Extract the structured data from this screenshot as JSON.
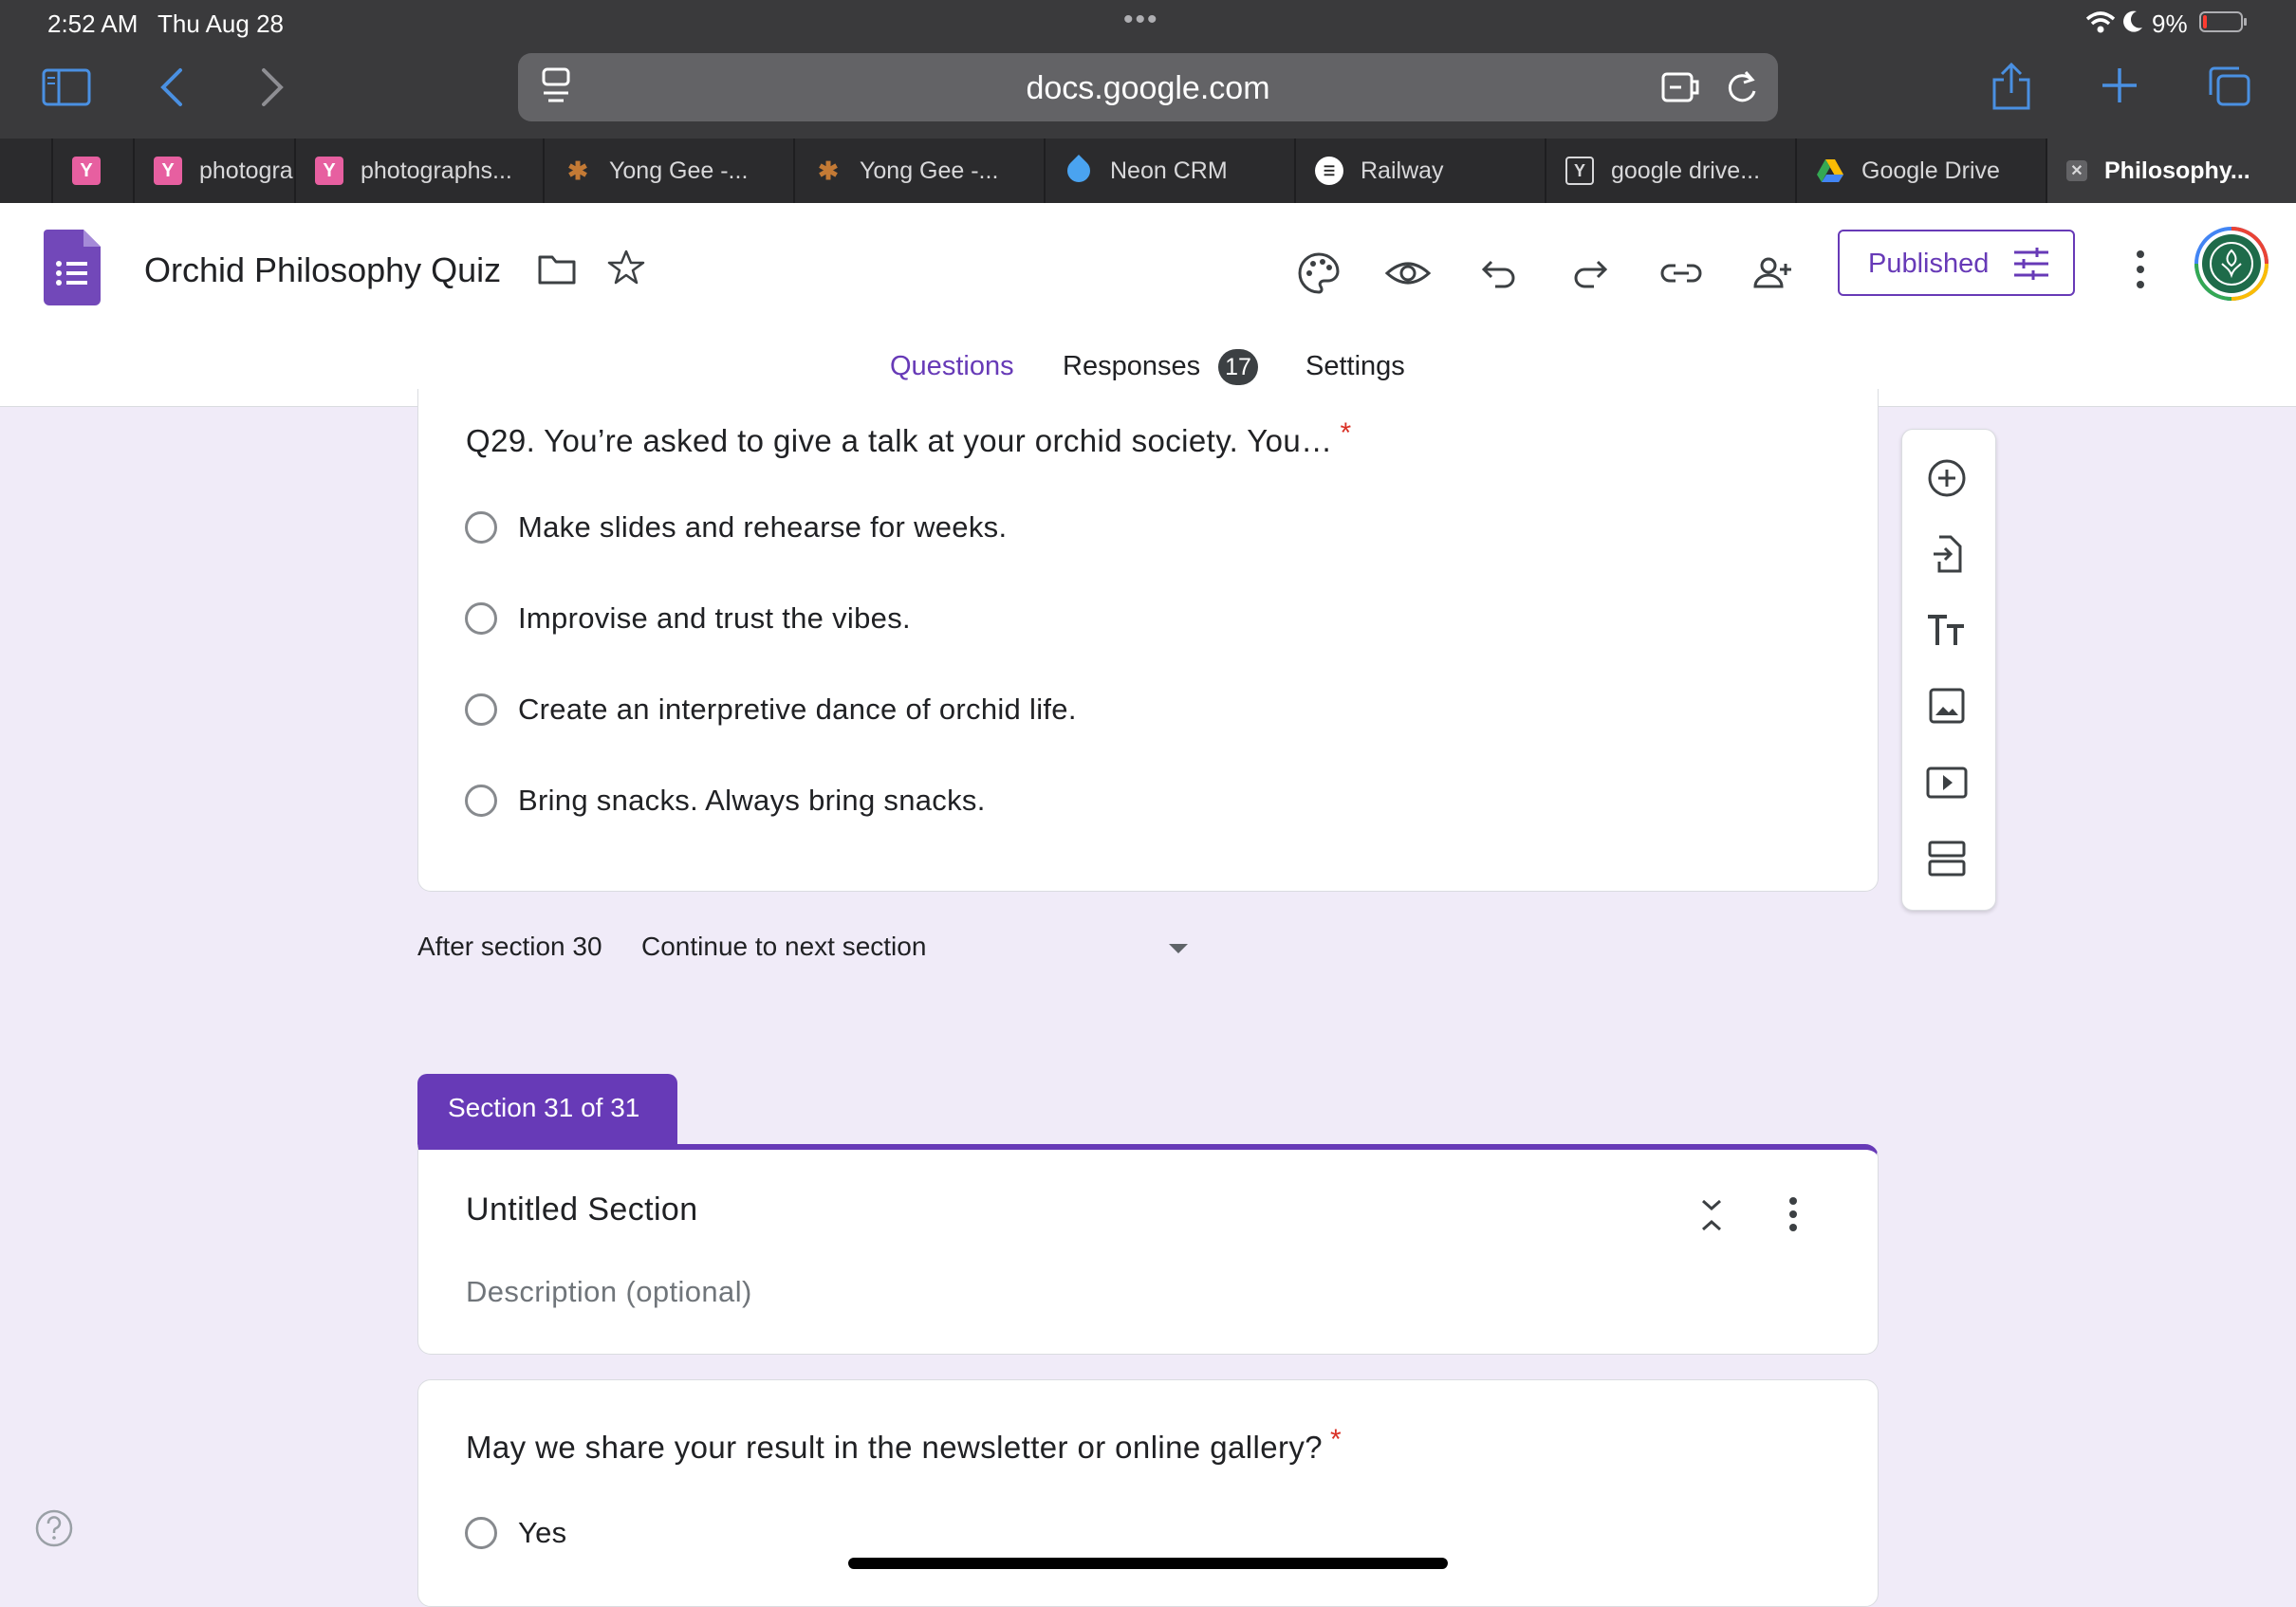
{
  "status": {
    "time": "2:52 AM",
    "date": "Thu Aug 28",
    "battery": "9%"
  },
  "browser": {
    "url": "docs.google.com",
    "tabs": [
      {
        "label": "",
        "fav": "Y",
        "color": "#e75fa0"
      },
      {
        "label": "photogra",
        "fav": "Y",
        "color": "#e75fa0"
      },
      {
        "label": "photographs...",
        "fav": "Y",
        "color": "#e75fa0"
      },
      {
        "label": "Yong Gee -...",
        "fav": "bug",
        "color": "#b5651d"
      },
      {
        "label": "Yong Gee -...",
        "fav": "bug",
        "color": "#b5651d"
      },
      {
        "label": "Neon CRM",
        "fav": "drop",
        "color": "#4aa3f0"
      },
      {
        "label": "Railway",
        "fav": "train",
        "color": "#ffffff"
      },
      {
        "label": "google drive...",
        "fav": "Y",
        "color": "#3a3a3c"
      },
      {
        "label": "Google Drive",
        "fav": "drive",
        "color": "#34a853"
      },
      {
        "label": "Philosophy...",
        "fav": "x",
        "color": "#8e8e93"
      }
    ]
  },
  "form": {
    "title": "Orchid Philosophy Quiz",
    "published_label": "Published",
    "tabs": {
      "questions": "Questions",
      "responses": "Responses",
      "responses_count": "17",
      "settings": "Settings"
    },
    "q29": {
      "title": "Q29. You’re asked to give a talk at your orchid society. You…",
      "required_mark": "*",
      "options": [
        "Make slides and rehearse for weeks.",
        "Improvise and trust the vibes.",
        "Create an interpretive dance of orchid life.",
        "Bring snacks. Always bring snacks."
      ]
    },
    "after_section": {
      "label": "After section 30",
      "value": "Continue to next section"
    },
    "section": {
      "badge": "Section 31 of 31",
      "title": "Untitled Section",
      "description_placeholder": "Description (optional)"
    },
    "q_share": {
      "title": "May we share your result in the newsletter or online gallery?",
      "required_mark": "*",
      "options": [
        "Yes"
      ]
    }
  },
  "colors": {
    "accent": "#673ab7",
    "required": "#d93025",
    "background": "#f0ebf8"
  }
}
